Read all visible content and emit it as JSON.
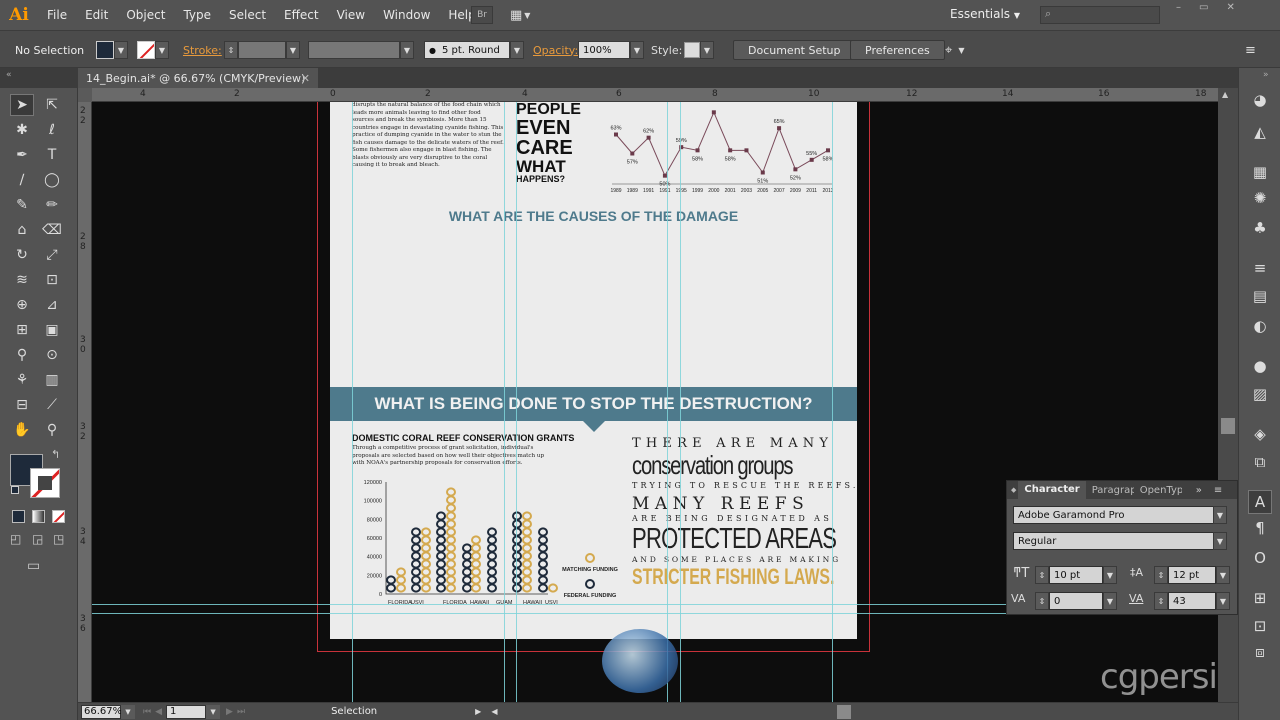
{
  "app": {
    "logo": "Ai"
  },
  "menubar": {
    "items": [
      "File",
      "Edit",
      "Object",
      "Type",
      "Select",
      "Effect",
      "View",
      "Window",
      "Help"
    ],
    "bridge_label": "Br",
    "workspace": "Essentials",
    "search_placeholder": ""
  },
  "controlbar": {
    "selection_status": "No Selection",
    "stroke_label": "Stroke:",
    "brush_label": "5 pt. Round",
    "opacity_label": "Opacity:",
    "opacity_value": "100%",
    "style_label": "Style:",
    "document_setup": "Document Setup",
    "preferences": "Preferences"
  },
  "document_tab": {
    "title": "14_Begin.ai* @ 66.67% (CMYK/Preview)"
  },
  "rulers": {
    "horizontal": [
      "4",
      "2",
      "0",
      "2",
      "4",
      "6",
      "8",
      "10",
      "12",
      "14",
      "16",
      "18"
    ],
    "vertical": [
      "2",
      "2",
      "2",
      "8",
      "3",
      "0",
      "3",
      "2",
      "3",
      "4",
      "3",
      "6"
    ]
  },
  "artboard": {
    "body_text": "disrupts the natural balance of the food chain which leads more animals leaving to find other food sources and break the symbiosis. More than 15 countries engage in devastating cyanide fishing. This practice of dumping cyanide in the water to stun the fish causes damage to the delicate waters of the reef. Some fishermen also engage in blast fishing. The blasts obviously are very disruptive to the coral causing it to break and bleach.",
    "question_lines": [
      "PEOPLE",
      "EVEN",
      "CARE",
      "WHAT",
      "HAPPENS?"
    ],
    "causes_heading": "WHAT ARE THE CAUSES OF THE DAMAGE",
    "banner_heading": "WHAT IS BEING DONE TO STOP THE DESTRUCTION?",
    "grants_heading": "DOMESTIC CORAL REEF CONSERVATION GRANTS",
    "grants_text": "Through a competitive process of grant solicitation, individual's proposals are selected based on how well their objectives match up with NOAA's partnership proposals for conservation efforts.",
    "bar_y_ticks": [
      "120000",
      "100000",
      "80000",
      "60000",
      "40000",
      "20000",
      "0"
    ],
    "bar_categories": [
      "FLORIDA",
      "USVI",
      "FLORIDA",
      "HAWAII",
      "GUAM",
      "HAWAII",
      "USVI"
    ],
    "legend_matching": "MATCHING FUNDING",
    "legend_federal": "FEDERAL FUNDING",
    "typo_lines": {
      "l1": "THERE ARE MANY",
      "l2": "conservation groups",
      "l3": "TRYING TO RESCUE THE REEFS.",
      "l4": "MANY REEFS",
      "l5": "ARE BEING DESIGNATED AS",
      "l6": "PROTECTED AREAS",
      "l7": "AND SOME PLACES ARE MAKING",
      "l8": "STRICTER FISHING LAWS."
    }
  },
  "chart_data": {
    "type": "line",
    "x": [
      "1989",
      "1989",
      "1991",
      "1991",
      "1995",
      "1999",
      "2000",
      "2001",
      "2003",
      "2005",
      "2007",
      "2009",
      "2011",
      "2013"
    ],
    "series": [
      {
        "values": [
          63,
          57,
          62,
          50,
          59,
          58,
          70,
          58,
          58,
          51,
          65,
          52,
          55,
          58
        ]
      }
    ],
    "point_labels": [
      "63%",
      "57%",
      "62%",
      "50%",
      "59%",
      "58%",
      "",
      "58%",
      "",
      "51%",
      "65%",
      "52%",
      "55%",
      "58%"
    ],
    "ylim": [
      48,
      72
    ],
    "grid": false
  },
  "character_panel": {
    "tabs": [
      "Character",
      "Paragraph",
      "OpenType"
    ],
    "font_family": "Adobe Garamond Pro",
    "font_style": "Regular",
    "font_size": "10 pt",
    "leading": "12 pt",
    "kerning": "0",
    "tracking": "43"
  },
  "statusbar": {
    "zoom": "66.67%",
    "artboard_number": "1",
    "tool_status": "Selection"
  },
  "colors": {
    "accent_teal": "#4e7a8c",
    "accent_gold": "#d4a94e",
    "navy": "#1e2a3a",
    "bleed": "#c8323a",
    "guide": "#7fd3d9"
  },
  "watermark": "cgpersia"
}
